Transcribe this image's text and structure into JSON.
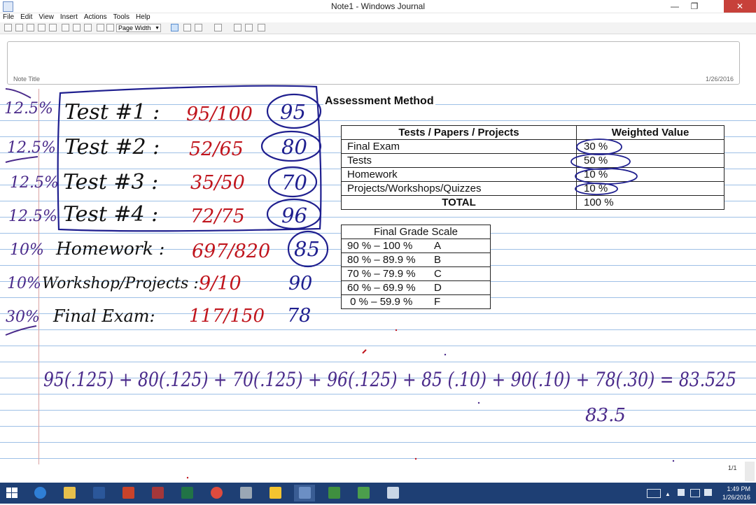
{
  "window": {
    "title": "Note1 - Windows Journal",
    "minimize": "—",
    "maximize": "❐",
    "close": "✕"
  },
  "menu": [
    "File",
    "Edit",
    "View",
    "Insert",
    "Actions",
    "Tools",
    "Help"
  ],
  "toolbar": {
    "zoom_value": "Page Width"
  },
  "note": {
    "title_label": "Note Title",
    "date": "1/26/2016",
    "page_indicator": "1/1"
  },
  "assessment": {
    "heading": "Assessment Method",
    "headers": [
      "Tests / Papers / Projects",
      "Weighted Value"
    ],
    "rows": [
      [
        "Final Exam",
        "30 %"
      ],
      [
        "Tests",
        "50 %"
      ],
      [
        "Homework",
        "10 %"
      ],
      [
        "Projects/Workshops/Quizzes",
        "10 %"
      ]
    ],
    "total": [
      "TOTAL",
      "100 %"
    ]
  },
  "grade_scale": {
    "heading": "Final Grade Scale",
    "rows": [
      [
        "90 % – 100 %",
        "A"
      ],
      [
        "80 % – 89.9 %",
        "B"
      ],
      [
        "70 % – 79.9 %",
        "C"
      ],
      [
        "60 % – 69.9 %",
        "D"
      ],
      [
        " 0 % – 59.9 %",
        "F"
      ]
    ]
  },
  "handwriting": {
    "weights": [
      "12.5%",
      "12.5%",
      "12.5%",
      "12.5%",
      "10%",
      "10%",
      "30%"
    ],
    "items": [
      "Test #1 :",
      "Test #2 :",
      "Test #3 :",
      "Test #4 :",
      "Homework :",
      "Workshop/Projects :",
      "Final Exam:"
    ],
    "scores": [
      "95/100",
      "52/65",
      "35/50",
      "72/75",
      "697/820",
      "9/10",
      "117/150"
    ],
    "percents": [
      "95",
      "80",
      "70",
      "96",
      "85",
      "90",
      "78"
    ],
    "equation": "95(.125) + 80(.125) + 70(.125) + 96(.125) + 85 (.10) + 90(.10) + 78(.30) = 83.525",
    "result": "83.5"
  },
  "taskbar": {
    "time": "1:49 PM",
    "date": "1/26/2016",
    "apps": [
      "start",
      "internet-explorer",
      "file-explorer",
      "word",
      "powerpoint",
      "access",
      "excel",
      "chrome",
      "snipping-tool",
      "google-drive",
      "journal",
      "camtasia",
      "camtasia-recorder",
      "notepad"
    ]
  },
  "colors": {
    "ink_blue": "#1f1f8f",
    "ink_red": "#c0151d",
    "ink_black": "#111111",
    "ink_purple": "#4a2a8a",
    "taskbar": "#1e3f74"
  }
}
